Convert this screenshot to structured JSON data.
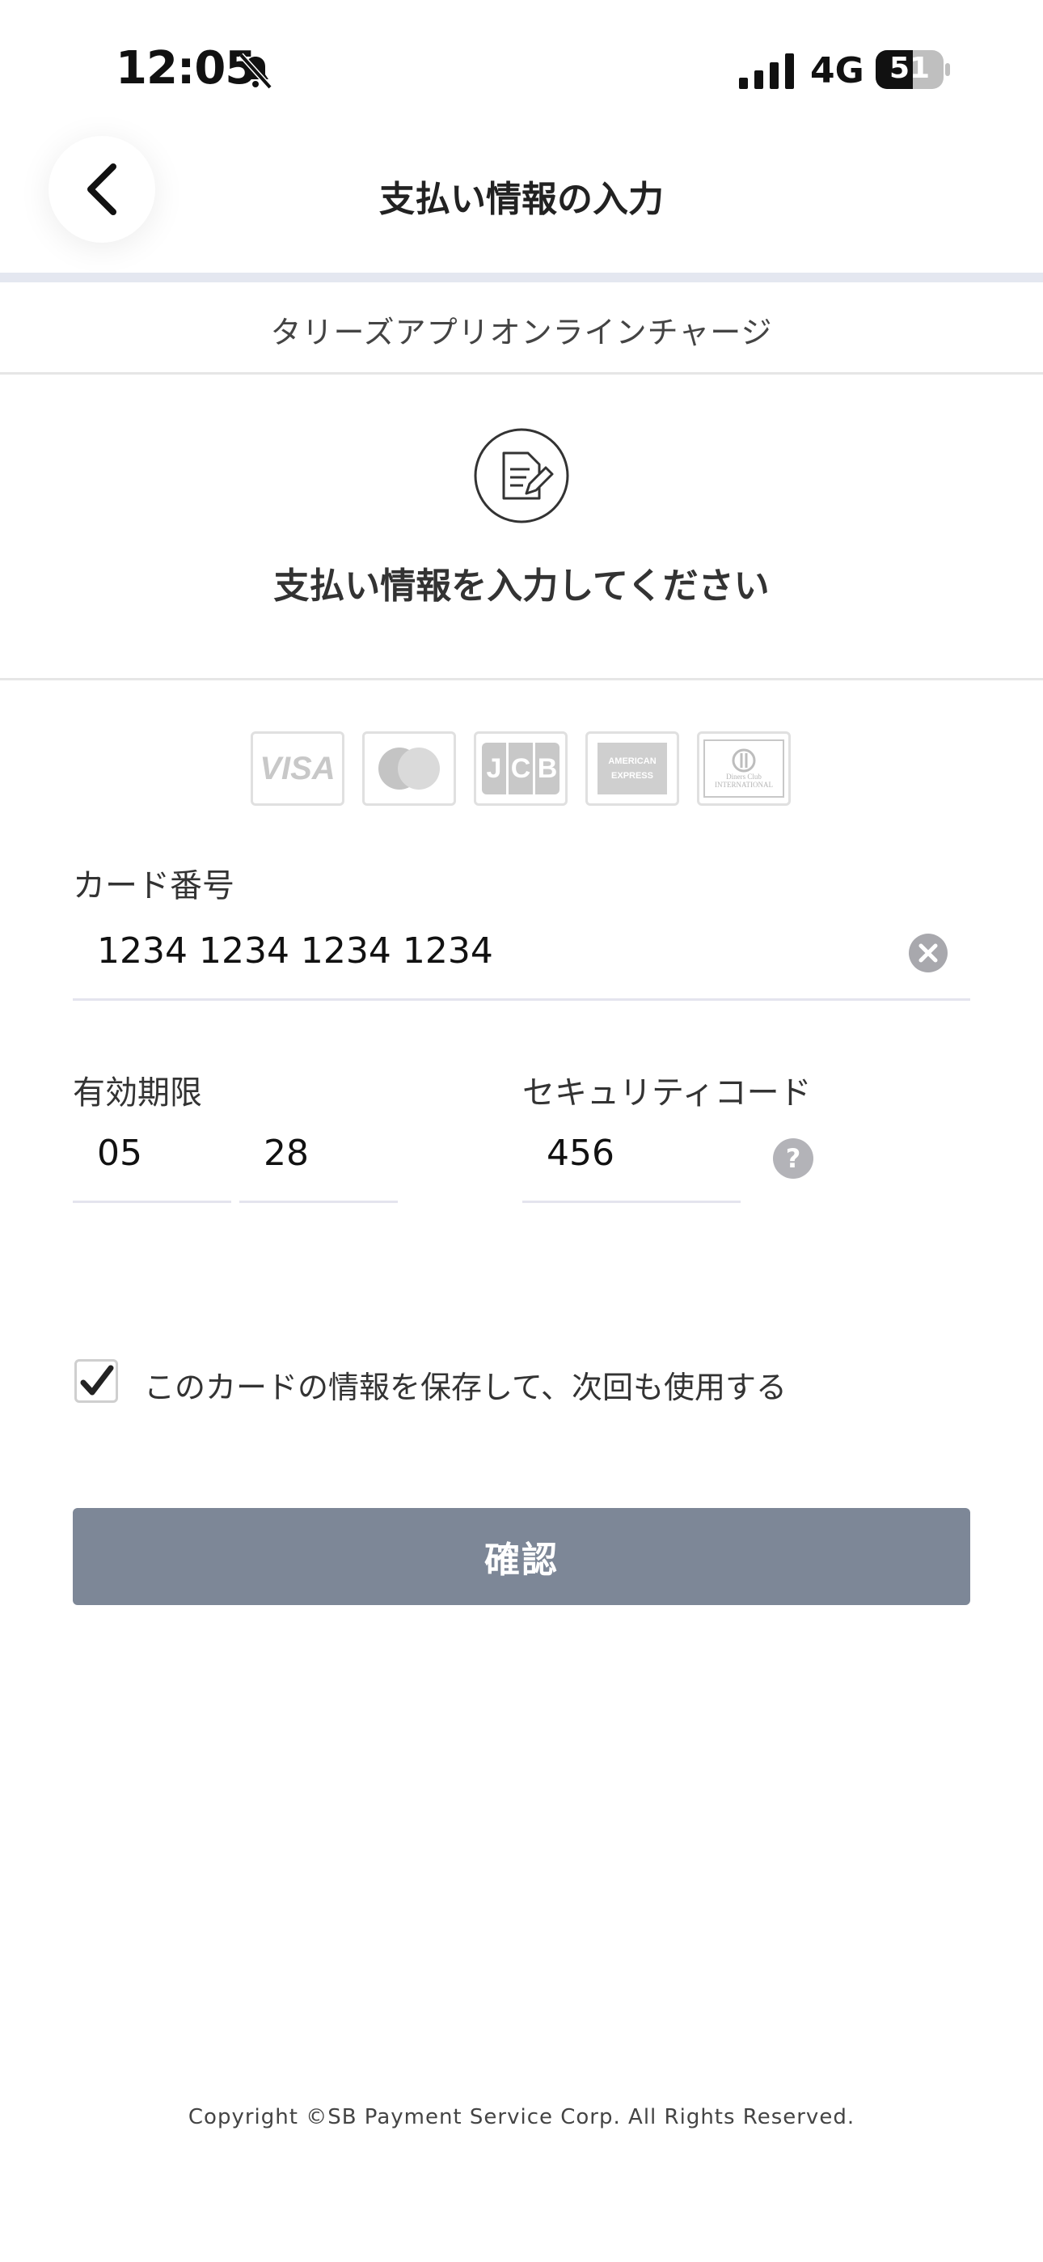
{
  "status_bar": {
    "time": "12:05",
    "network": "4G",
    "battery": "51",
    "icons": [
      "bell-slash-icon",
      "signal-icon",
      "battery-icon"
    ]
  },
  "header": {
    "title": "支払い情報の入力",
    "back_icon": "chevron-left-icon"
  },
  "merchant": {
    "name": "タリーズアプリオンラインチャージ"
  },
  "instruction": {
    "icon": "document-edit-icon",
    "text": "支払い情報を入力してください"
  },
  "card_brands": [
    {
      "name": "VISA",
      "icon": "visa-logo"
    },
    {
      "name": "Mastercard",
      "icon": "mastercard-logo"
    },
    {
      "name": "JCB",
      "icon": "jcb-logo"
    },
    {
      "name": "AMERICAN EXPRESS",
      "icon": "amex-logo"
    },
    {
      "name": "Diners Club INTERNATIONAL",
      "icon": "diners-club-logo"
    }
  ],
  "form": {
    "card_number_label": "カード番号",
    "card_number_value": "1234 1234 1234 1234",
    "expiry_label": "有効期限",
    "expiry_month": "05",
    "expiry_year": "28",
    "security_code_label": "セキュリティコード",
    "security_code_value": "456",
    "save_card_label": "このカードの情報を保存して、次回も使用する",
    "save_card_checked": true,
    "confirm_label": "確認"
  },
  "footer": {
    "copyright": "Copyright ©SB Payment Service Corp. All Rights Reserved."
  },
  "colors": {
    "button": "#7d8797",
    "divider": "#e4e7f0",
    "text": "#333333"
  }
}
